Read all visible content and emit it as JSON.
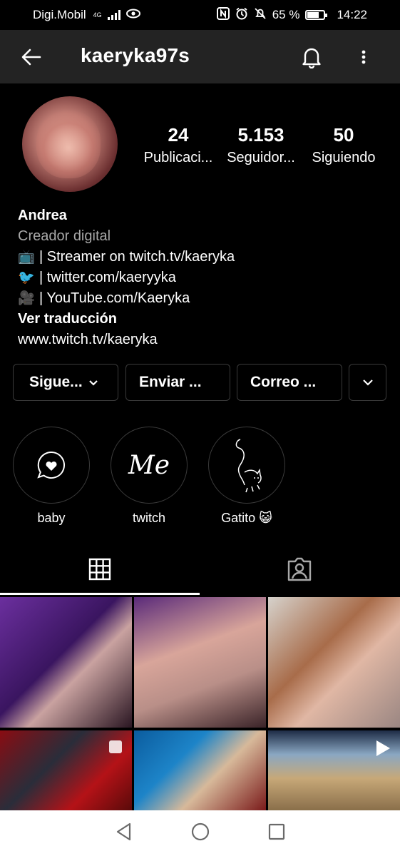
{
  "status_bar": {
    "carrier": "Digi.Mobil",
    "network": "4G",
    "battery": "65 %",
    "time": "14:22"
  },
  "header": {
    "username": "kaeryka97s",
    "back_icon": "arrow-left-icon",
    "bell_icon": "bell-icon",
    "more_icon": "more-vertical-icon"
  },
  "stats": [
    {
      "number": "24",
      "label": "Publicaci..."
    },
    {
      "number": "5.153",
      "label": "Seguidor..."
    },
    {
      "number": "50",
      "label": "Siguiendo"
    }
  ],
  "bio": {
    "name": "Andrea",
    "category": "Creador digital",
    "lines": [
      {
        "emoji": "📺",
        "text": "| Streamer on twitch.tv/kaeryka"
      },
      {
        "emoji": "🐦",
        "text": "| twitter.com/kaeryyka"
      },
      {
        "emoji": "🎥",
        "text": "| YouTube.com/Kaeryka"
      }
    ],
    "translate": "Ver traducción",
    "link": "www.twitch.tv/kaeryka"
  },
  "buttons": {
    "following": "Sigue...",
    "message": "Enviar ...",
    "email": "Correo ..."
  },
  "highlights": [
    {
      "label": "baby",
      "icon": "heart-bubble-icon"
    },
    {
      "label": "twitch",
      "icon": "me-script-icon",
      "text": "Me"
    },
    {
      "label": "Gatito 😺",
      "icon": "cat-drawing-icon"
    }
  ],
  "tabs": {
    "grid_icon": "grid-icon",
    "tagged_icon": "tagged-person-icon"
  },
  "colors": {
    "background": "#000000",
    "header_bg": "#232323",
    "border": "#3a3a3a",
    "secondary_text": "#a8a8a8"
  }
}
